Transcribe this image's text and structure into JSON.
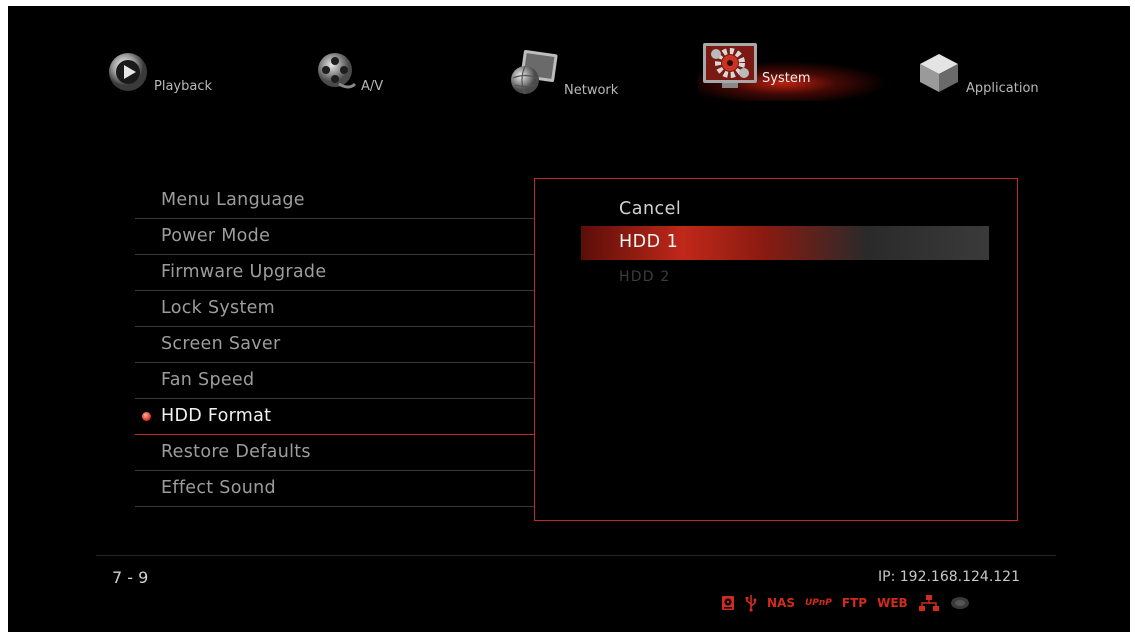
{
  "nav": {
    "items": [
      {
        "label": "Playback",
        "icon": "play-disc-icon"
      },
      {
        "label": "A/V",
        "icon": "film-reel-icon"
      },
      {
        "label": "Network",
        "icon": "globe-monitor-icon"
      },
      {
        "label": "System",
        "icon": "gear-monitor-icon",
        "selected": true
      },
      {
        "label": "Application",
        "icon": "cube-icon"
      }
    ]
  },
  "menu": {
    "items": [
      {
        "label": "Menu Language"
      },
      {
        "label": "Power Mode"
      },
      {
        "label": "Firmware Upgrade"
      },
      {
        "label": "Lock System"
      },
      {
        "label": "Screen Saver"
      },
      {
        "label": "Fan Speed"
      },
      {
        "label": "HDD Format",
        "active": true
      },
      {
        "label": "Restore Defaults"
      },
      {
        "label": "Effect Sound"
      }
    ]
  },
  "submenu": {
    "options": [
      {
        "label": "Cancel"
      },
      {
        "label": "HDD 1",
        "highlighted": true
      },
      {
        "label": "HDD 2",
        "disabled": true
      }
    ]
  },
  "footer": {
    "page": "7 - 9",
    "ip": "IP: 192.168.124.121",
    "status_icons": [
      {
        "name": "hdd-icon"
      },
      {
        "name": "usb-icon"
      },
      {
        "name": "nas-label",
        "text": "NAS"
      },
      {
        "name": "upnp-label",
        "text": "UPnP"
      },
      {
        "name": "ftp-label",
        "text": "FTP"
      },
      {
        "name": "web-label",
        "text": "WEB"
      },
      {
        "name": "network-icon"
      },
      {
        "name": "wifi-icon"
      }
    ]
  },
  "colors": {
    "accent": "#c0282a",
    "background": "#000000",
    "text_dim": "#9d9d9d",
    "text_active": "#f2f2f2"
  }
}
